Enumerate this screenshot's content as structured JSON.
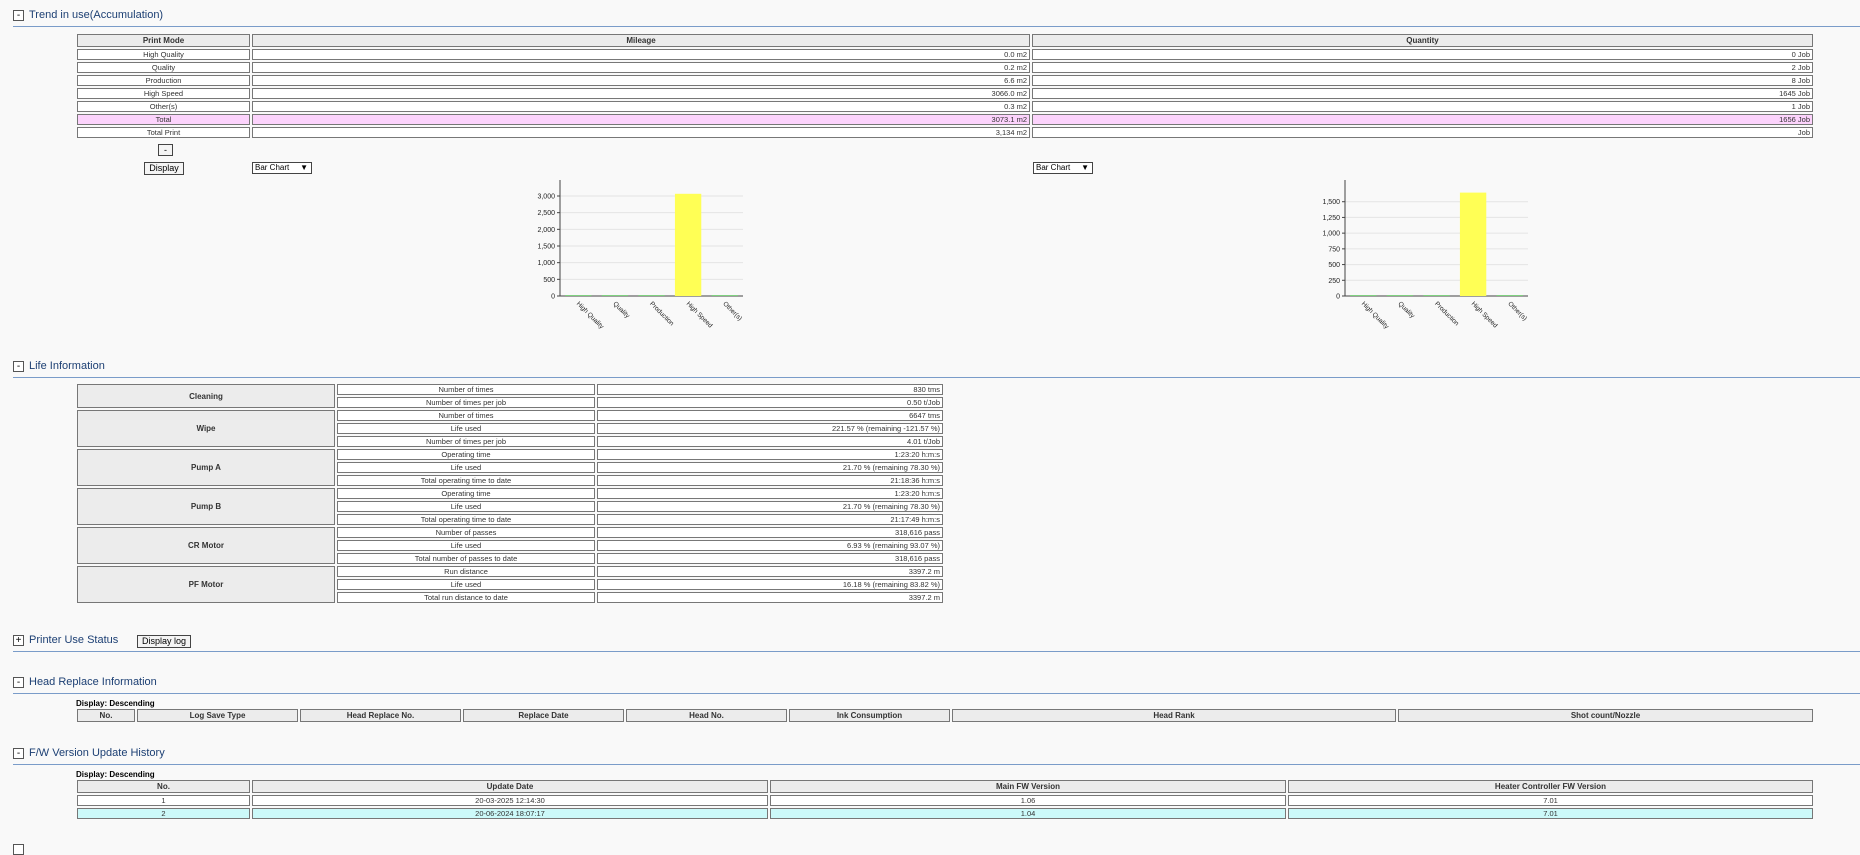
{
  "trend": {
    "title": "Trend in use(Accumulation)",
    "toggle": "-",
    "headers": [
      "Print Mode",
      "Mileage",
      "Quantity"
    ],
    "rows": [
      {
        "mode": "High Quality",
        "mileage": "0.0 m2",
        "quantity": "0 Job"
      },
      {
        "mode": "Quality",
        "mileage": "0.2 m2",
        "quantity": "2 Job"
      },
      {
        "mode": "Production",
        "mileage": "6.6 m2",
        "quantity": "8 Job"
      },
      {
        "mode": "High Speed",
        "mileage": "3066.0 m2",
        "quantity": "1645 Job"
      },
      {
        "mode": "Other(s)",
        "mileage": "0.3 m2",
        "quantity": "1 Job"
      },
      {
        "mode": "Total",
        "mileage": "3073.1 m2",
        "quantity": "1656 Job"
      },
      {
        "mode": "Total Print",
        "mileage": "3,134 m2",
        "quantity": "Job"
      }
    ],
    "collapse_btn": "-",
    "display_btn": "Display",
    "chart_type_mileage": "Bar Chart",
    "chart_type_quantity": "Bar Chart"
  },
  "chart_data": [
    {
      "type": "bar",
      "categories": [
        "High Quality",
        "Quality",
        "Production",
        "High Speed",
        "Other(s)"
      ],
      "values": [
        0.0,
        0.2,
        6.6,
        3066.0,
        0.3
      ],
      "yticks": [
        0,
        500,
        1000,
        1500,
        2000,
        2500,
        3000
      ],
      "ytick_labels": [
        "0",
        "500",
        "1,000",
        "1,500",
        "2,000",
        "2,500",
        "3,000"
      ],
      "ylim": [
        0,
        3300
      ],
      "grid": true,
      "colors": [
        "#7fd07f",
        "#7fd07f",
        "#7fd07f",
        "#ffff55",
        "#7fd07f"
      ]
    },
    {
      "type": "bar",
      "categories": [
        "High Quality",
        "Quality",
        "Production",
        "High Speed",
        "Other(s)"
      ],
      "values": [
        0,
        2,
        8,
        1645,
        1
      ],
      "yticks": [
        0,
        250,
        500,
        750,
        1000,
        1250,
        1500
      ],
      "ytick_labels": [
        "0",
        "250",
        "500",
        "750",
        "1,000",
        "1,250",
        "1,500"
      ],
      "ylim": [
        0,
        1750
      ],
      "grid": true,
      "colors": [
        "#7fd07f",
        "#7fd07f",
        "#7fd07f",
        "#ffff55",
        "#7fd07f"
      ]
    }
  ],
  "life": {
    "title": "Life Information",
    "toggle": "-",
    "groups": [
      {
        "name": "Cleaning",
        "rows": [
          {
            "label": "Number of times",
            "value": "830 tms"
          },
          {
            "label": "Number of times per job",
            "value": "0.50 t/Job"
          }
        ]
      },
      {
        "name": "Wipe",
        "rows": [
          {
            "label": "Number of times",
            "value": "6647 tms"
          },
          {
            "label": "Life used",
            "value": "221.57 % (remaining -121.57 %)"
          },
          {
            "label": "Number of times per job",
            "value": "4.01 t/Job"
          }
        ]
      },
      {
        "name": "Pump A",
        "rows": [
          {
            "label": "Operating time",
            "value": "1:23:20 h:m:s"
          },
          {
            "label": "Life used",
            "value": "21.70 % (remaining 78.30 %)"
          },
          {
            "label": "Total operating time to date",
            "value": "21:18:36 h:m:s"
          }
        ]
      },
      {
        "name": "Pump B",
        "rows": [
          {
            "label": "Operating time",
            "value": "1:23:20 h:m:s"
          },
          {
            "label": "Life used",
            "value": "21.70 % (remaining 78.30 %)"
          },
          {
            "label": "Total operating time to date",
            "value": "21:17:49 h:m:s"
          }
        ]
      },
      {
        "name": "CR Motor",
        "rows": [
          {
            "label": "Number of passes",
            "value": "318,616 pass"
          },
          {
            "label": "Life used",
            "value": "6.93 % (remaining 93.07 %)"
          },
          {
            "label": "Total number of passes to date",
            "value": "318,616 pass"
          }
        ]
      },
      {
        "name": "PF Motor",
        "rows": [
          {
            "label": "Run distance",
            "value": "3397.2 m"
          },
          {
            "label": "Life used",
            "value": "16.18 % (remaining 83.82 %)"
          },
          {
            "label": "Total run distance to date",
            "value": "3397.2 m"
          }
        ]
      }
    ]
  },
  "printer_use": {
    "title": "Printer Use Status",
    "toggle": "+",
    "display_log_btn": "Display log"
  },
  "head_replace": {
    "title": "Head Replace Information",
    "toggle": "-",
    "display_label": "Display: Descending",
    "headers": [
      "No.",
      "Log Save Type",
      "Head Replace No.",
      "Replace Date",
      "Head No.",
      "Ink Consumption",
      "Head Rank",
      "Shot count/Nozzle"
    ]
  },
  "fw": {
    "title": "F/W Version Update History",
    "toggle": "-",
    "display_label": "Display: Descending",
    "headers": [
      "No.",
      "Update Date",
      "Main FW Version",
      "Heater Controller FW Version"
    ],
    "rows": [
      {
        "no": "1",
        "date": "20-03-2025 12:14:30",
        "main": "1.06",
        "heater": "7.01"
      },
      {
        "no": "2",
        "date": "20-06-2024 18:07:17",
        "main": "1.04",
        "heater": "7.01"
      }
    ]
  }
}
